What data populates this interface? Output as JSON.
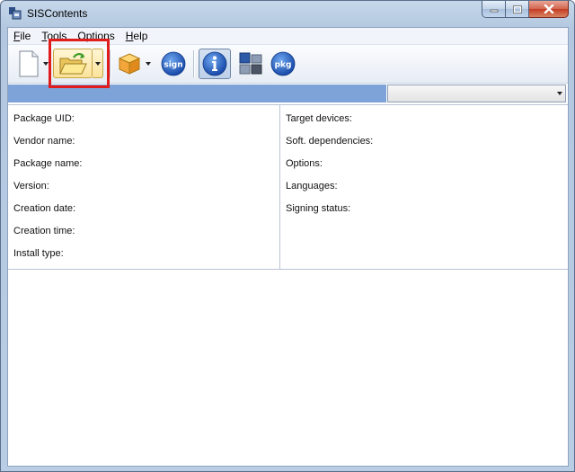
{
  "window": {
    "title": "SISContents"
  },
  "menu": [
    {
      "underline": "F",
      "rest": "ile"
    },
    {
      "underline": "T",
      "rest": "ools"
    },
    {
      "underline": "O",
      "rest": "ptions"
    },
    {
      "underline": "H",
      "rest": "elp"
    }
  ],
  "toolbar": {
    "sign_label": "sign",
    "pkg_label": "pkg"
  },
  "info_left": [
    "Package UID:",
    "Vendor name:",
    "Package name:",
    "Version:",
    "Creation date:",
    "Creation time:",
    "Install type:"
  ],
  "info_right": [
    "Target devices:",
    "Soft. dependencies:",
    "Options:",
    "Languages:",
    "Signing status:"
  ],
  "colors": {
    "highlight": "#e01c1c",
    "blue_bar": "#7ea3d9"
  }
}
